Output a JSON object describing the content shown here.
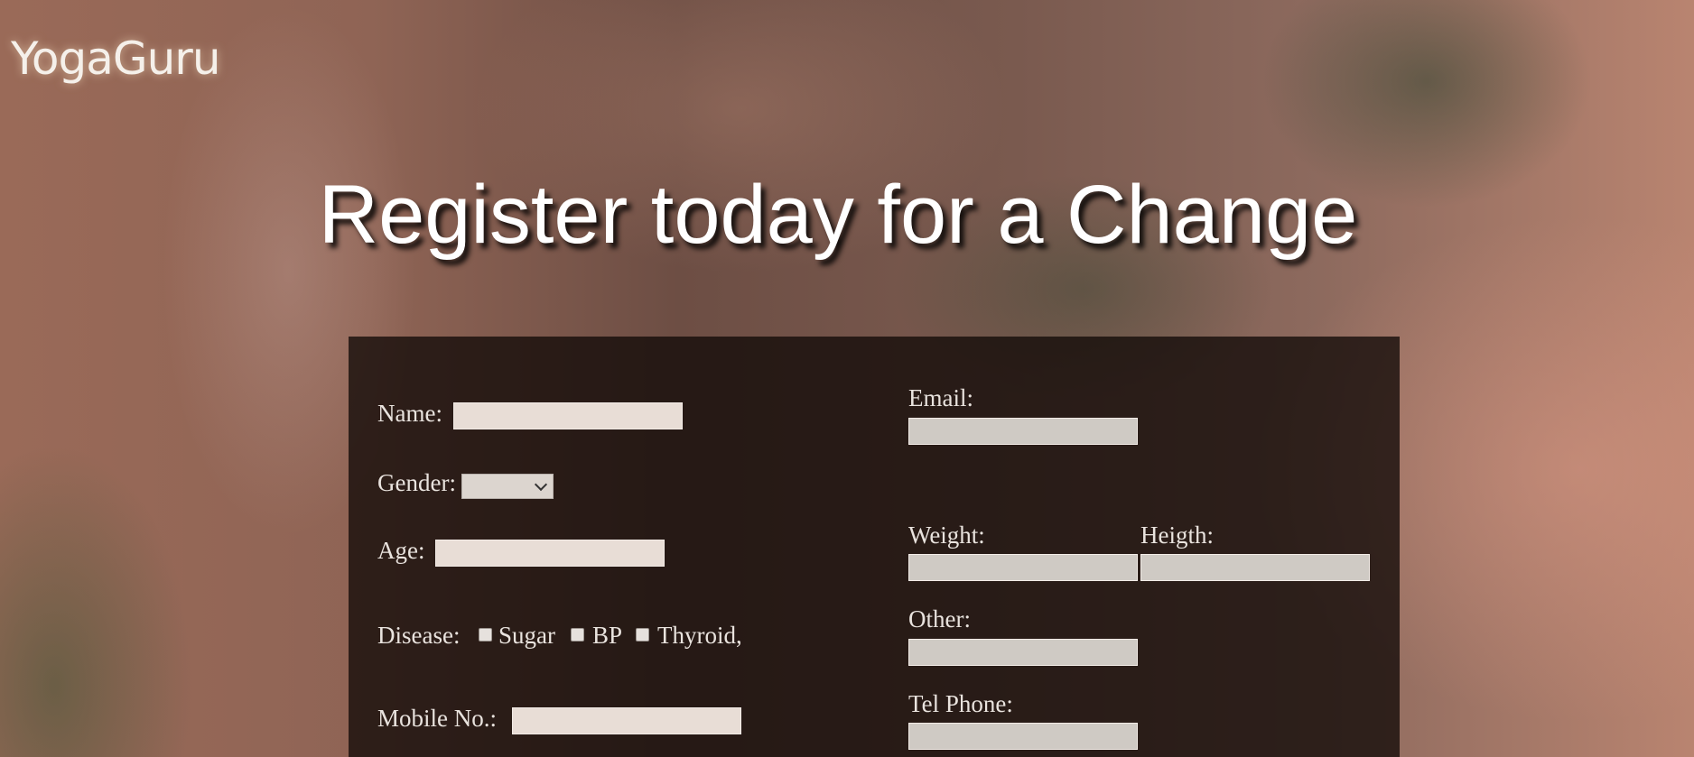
{
  "brand": {
    "logo_text": "YogaGuru"
  },
  "hero": {
    "title": "Register today for a Change"
  },
  "form": {
    "name_label": "Name:",
    "gender_label": "Gender:",
    "gender_selected": "",
    "age_label": "Age:",
    "disease_label": "Disease:",
    "disease_options": [
      "Sugar",
      "BP",
      "Thyroid,"
    ],
    "mobile_label": "Mobile No.:",
    "email_label": "Email:",
    "weight_label": "Weight:",
    "height_label": "Heigth:",
    "other_label": "Other:",
    "tel_label": "Tel Phone:"
  }
}
